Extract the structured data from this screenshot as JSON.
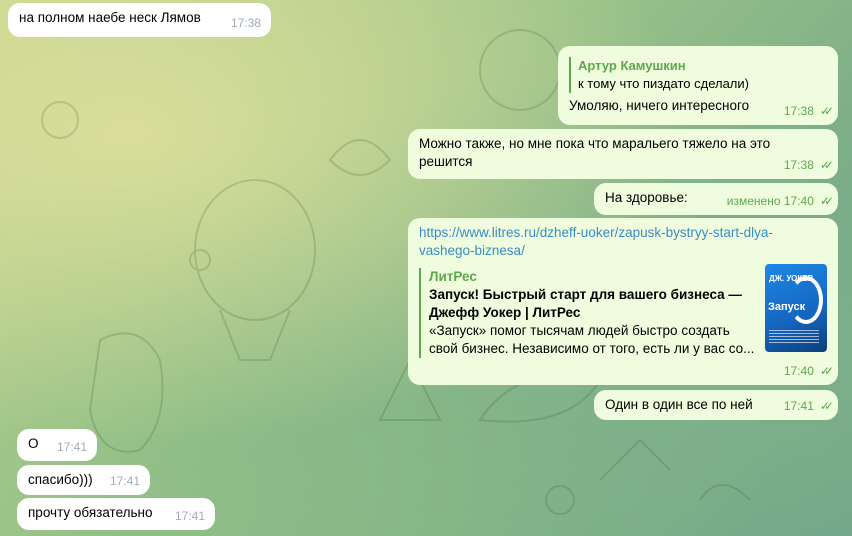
{
  "messages": [
    {
      "text": "на полном наебе неск Лямов",
      "time": "17:38"
    },
    {
      "reply_name": "Артур Камушкин",
      "reply_text": "к тому что пиздато сделали)",
      "text": "Умоляю, ничего интересного",
      "time": "17:38"
    },
    {
      "text": "Можно также, но мне пока что маральего тяжело на это\nрешится",
      "time": "17:38"
    },
    {
      "text": "На здоровье:",
      "time": "изменено 17:40"
    },
    {
      "link": "https://www.litres.ru/dzheff-uoker/zapusk-bystryy-start-dlya-\nvashego-biznesa/",
      "time": "17:40",
      "preview": {
        "site": "ЛитРес",
        "title": "Запуск! Быстрый старт для вашего бизнеса —\nДжефф Уокер | ЛитРес",
        "description": "«Запуск» помог тысячам людей быстро создать\nсвой бизнес. Независимо от того, есть ли у вас со...",
        "cover_author": "ДЖ. УОКЕР",
        "cover_title": "Запуск"
      }
    },
    {
      "text": "Один в один все по ней",
      "time": "17:41"
    },
    {
      "text": "О",
      "time": "17:41"
    },
    {
      "text": "спасибо)))",
      "time": "17:41"
    },
    {
      "text": "прочту обязательно",
      "time": "17:41"
    }
  ],
  "colors": {
    "outgoing": "#effdde",
    "incoming": "#ffffff",
    "accent": "#5ea84e",
    "link": "#3a8cc4"
  },
  "icons": {
    "read_receipt": "double-check-icon"
  }
}
